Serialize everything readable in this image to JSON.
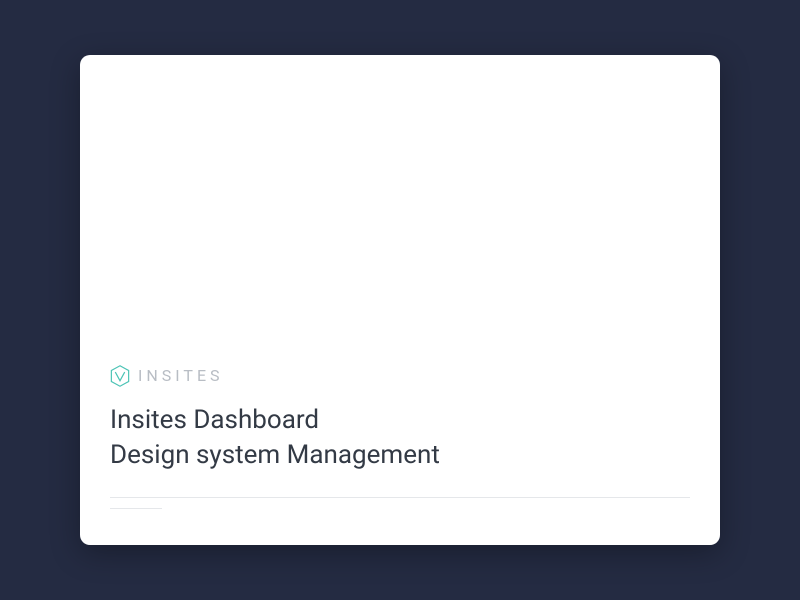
{
  "brand": {
    "name": "INSITES",
    "logo_color": "#4bc3b5"
  },
  "card": {
    "title_line1": "Insites Dashboard",
    "title_line2": "Design system Management"
  },
  "colors": {
    "background": "#242b42",
    "card_bg": "#ffffff",
    "title_text": "#333a45",
    "brand_text": "#b8bdc4",
    "divider": "#e5e7ea"
  }
}
